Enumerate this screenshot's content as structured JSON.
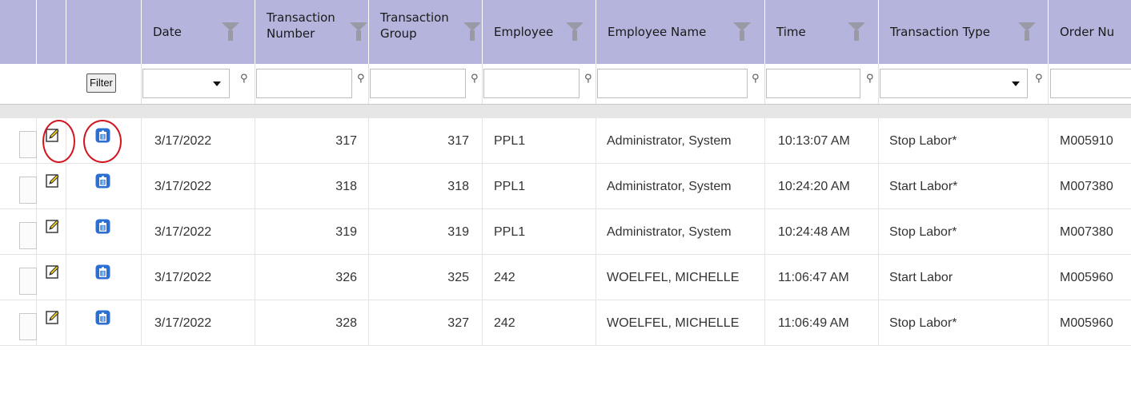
{
  "columns": [
    {
      "key": "date",
      "label_lines": [
        "Date"
      ]
    },
    {
      "key": "txn_number",
      "label_lines": [
        "Transaction",
        "Number"
      ]
    },
    {
      "key": "txn_group",
      "label_lines": [
        "Transaction",
        "Group"
      ]
    },
    {
      "key": "employee",
      "label_lines": [
        "Employee"
      ]
    },
    {
      "key": "employee_name",
      "label_lines": [
        "Employee Name"
      ]
    },
    {
      "key": "time",
      "label_lines": [
        "Time"
      ]
    },
    {
      "key": "txn_type",
      "label_lines": [
        "Transaction Type"
      ]
    },
    {
      "key": "order_number",
      "label_lines": [
        "Order Nu"
      ]
    }
  ],
  "filter_button_label": "Filter",
  "filter_pin_glyph": "⚲",
  "rows": [
    {
      "date": "3/17/2022",
      "txn_number": "317",
      "txn_group": "317",
      "employee": "PPL1",
      "employee_name": "Administrator, System",
      "time": "10:13:07 AM",
      "txn_type": "Stop Labor*",
      "order_number": "M005910"
    },
    {
      "date": "3/17/2022",
      "txn_number": "318",
      "txn_group": "318",
      "employee": "PPL1",
      "employee_name": "Administrator, System",
      "time": "10:24:20 AM",
      "txn_type": "Start Labor*",
      "order_number": "M007380"
    },
    {
      "date": "3/17/2022",
      "txn_number": "319",
      "txn_group": "319",
      "employee": "PPL1",
      "employee_name": "Administrator, System",
      "time": "10:24:48 AM",
      "txn_type": "Stop Labor*",
      "order_number": "M007380"
    },
    {
      "date": "3/17/2022",
      "txn_number": "326",
      "txn_group": "325",
      "employee": "242",
      "employee_name": "WOELFEL, MICHELLE",
      "time": "11:06:47 AM",
      "txn_type": "Start Labor",
      "order_number": "M005960"
    },
    {
      "date": "3/17/2022",
      "txn_number": "328",
      "txn_group": "327",
      "employee": "242",
      "employee_name": "WOELFEL, MICHELLE",
      "time": "11:06:49 AM",
      "txn_type": "Stop Labor*",
      "order_number": "M005960"
    }
  ],
  "icons": {
    "edit": "edit-icon",
    "delete": "delete-icon",
    "filter_pin": "filter-pin-icon",
    "column_filter": "funnel-icon"
  },
  "colors": {
    "header_bg": "#b4b4dc",
    "highlight_circle": "#d4151f",
    "delete_icon": "#2d6fd0"
  }
}
